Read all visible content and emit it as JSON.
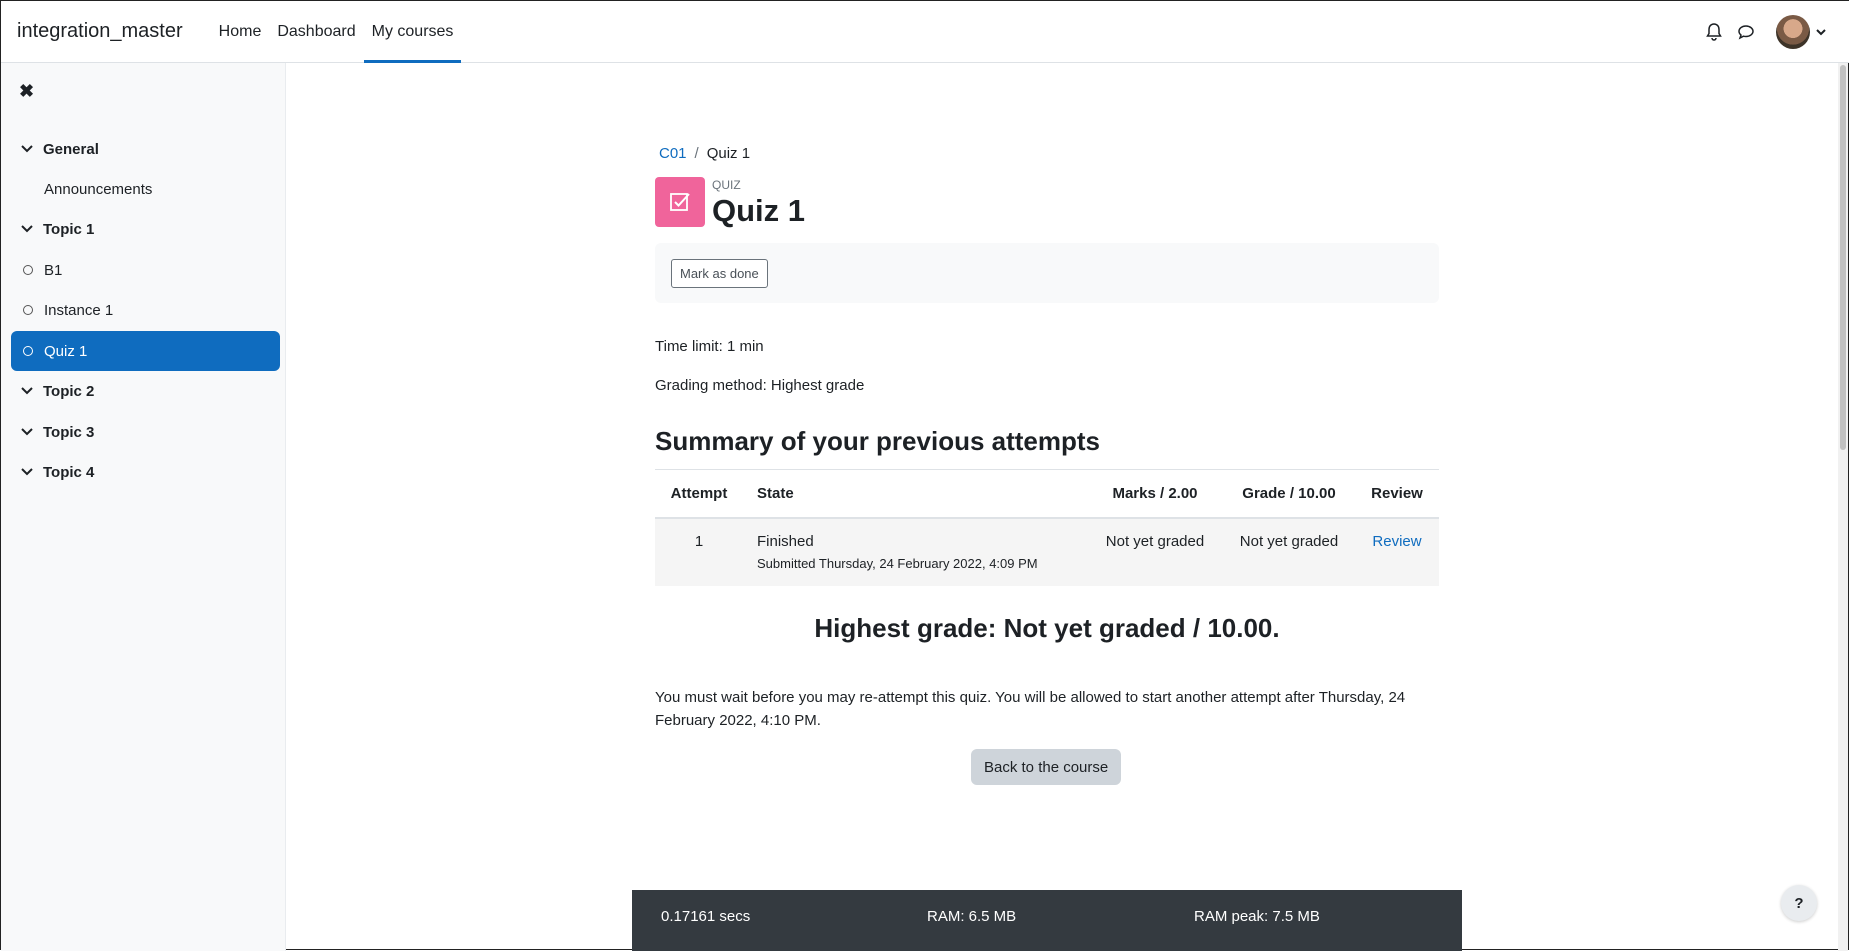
{
  "navbar": {
    "brand": "integration_master",
    "links": [
      "Home",
      "Dashboard",
      "My courses"
    ],
    "active": "My courses",
    "icons": [
      "bell-icon",
      "chat-icon",
      "user-avatar",
      "chevron-down-icon"
    ]
  },
  "drawer": {
    "close_icon": "✖",
    "items": [
      {
        "type": "section",
        "label": "General"
      },
      {
        "type": "sub",
        "label": "Announcements"
      },
      {
        "type": "section",
        "label": "Topic 1"
      },
      {
        "type": "activity",
        "label": "B1"
      },
      {
        "type": "activity",
        "label": "Instance 1"
      },
      {
        "type": "activity",
        "label": "Quiz 1",
        "active": true
      },
      {
        "type": "section",
        "label": "Topic 2"
      },
      {
        "type": "section",
        "label": "Topic 3"
      },
      {
        "type": "section",
        "label": "Topic 4"
      }
    ]
  },
  "breadcrumb": {
    "course": "C01",
    "separator": "/",
    "current": "Quiz 1"
  },
  "header": {
    "purpose": "QUIZ",
    "title": "Quiz 1"
  },
  "completion": {
    "button": "Mark as done"
  },
  "info": {
    "time_limit": "Time limit: 1 min",
    "grading_method": "Grading method: Highest grade"
  },
  "summary": {
    "heading": "Summary of your previous attempts",
    "columns": [
      "Attempt",
      "State",
      "Marks / 2.00",
      "Grade / 10.00",
      "Review"
    ],
    "rows": [
      {
        "attempt": "1",
        "state": "Finished",
        "submitted": "Submitted Thursday, 24 February 2022, 4:09 PM",
        "marks": "Not yet graded",
        "grade": "Not yet graded",
        "review": "Review"
      }
    ]
  },
  "highest_grade": "Highest grade: Not yet graded / 10.00.",
  "wait_message": "You must wait before you may re-attempt this quiz. You will be allowed to start another attempt after Thursday, 24 February 2022, 4:10 PM.",
  "back_button": "Back to the course",
  "perf": {
    "time": "0.17161 secs",
    "ram": "RAM: 6.5 MB",
    "ram_peak": "RAM peak: 7.5 MB"
  },
  "help": "?",
  "colors": {
    "primary": "#0f6cbf",
    "quiz_icon": "#f0649b",
    "footer": "#343a40"
  }
}
